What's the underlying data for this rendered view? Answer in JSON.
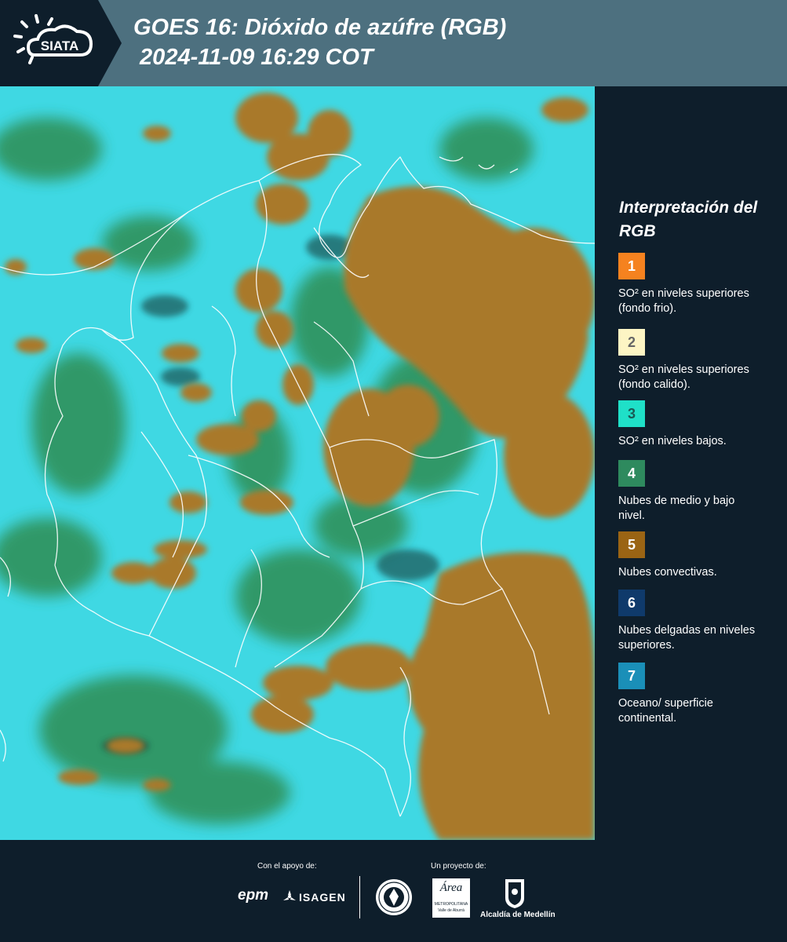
{
  "header": {
    "logo_text": "SIATA",
    "title_line1": "GOES 16: Dióxido de azúfre (RGB)",
    "title_line2": " 2024-11-09 16:29 COT"
  },
  "legend": {
    "title": "Interpretación del RGB",
    "items": [
      {
        "number": "1",
        "color": "#f5821f",
        "text": "SO² en niveles superiores (fondo frio)."
      },
      {
        "number": "2",
        "color": "#fdf5c4",
        "text": "SO² en niveles superiores (fondo calido)."
      },
      {
        "number": "3",
        "color": "#1fe0c8",
        "text": "SO² en niveles bajos."
      },
      {
        "number": "4",
        "color": "#2e8a5e",
        "text": "Nubes de medio y bajo nivel."
      },
      {
        "number": "5",
        "color": "#9a6414",
        "text": "Nubes convectivas."
      },
      {
        "number": "6",
        "color": "#0f3a6b",
        "text": "Nubes delgadas en niveles superiores."
      },
      {
        "number": "7",
        "color": "#1a8fb8",
        "text": "Oceano/ superficie continental."
      }
    ]
  },
  "footer": {
    "support_label": "Con el apoyo de:",
    "project_label": "Un proyecto de:",
    "sponsor_epm": "epm",
    "sponsor_isagen": "ISAGEN",
    "partner_area": "Área",
    "partner_area_sub1": "METROPOLITANA",
    "partner_area_sub2": "Valle de Aburrá",
    "partner_alcaldia": "Alcaldía de Medellín"
  },
  "colors": {
    "background": "#0e1e2b",
    "header_band": "#4d707f",
    "clear_sky": "#3fd8e3",
    "convective": "#a9792a",
    "low_cloud": "#2d8c4e",
    "borders": "#ffffff"
  }
}
